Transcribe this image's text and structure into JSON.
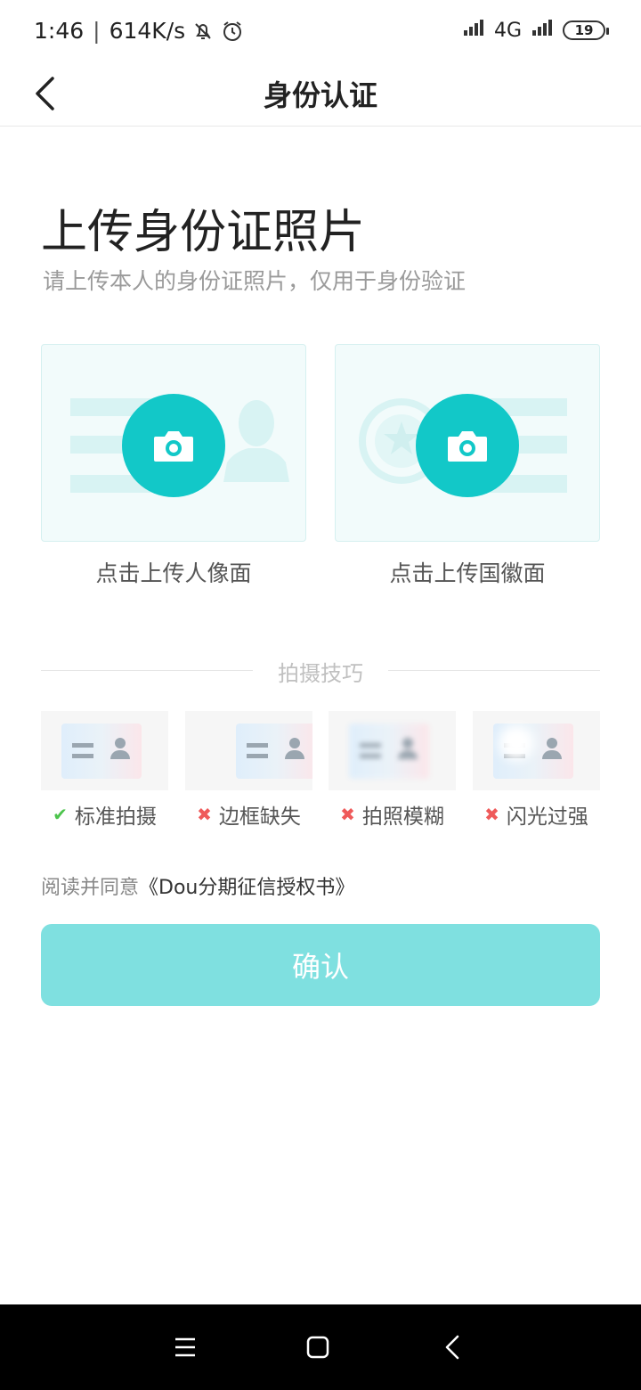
{
  "status_bar": {
    "time": "1:46",
    "separator": "|",
    "speed": "614K/s",
    "network": "4G",
    "battery": "19"
  },
  "nav": {
    "title": "身份认证"
  },
  "page": {
    "title": "上传身份证照片",
    "subtitle": "请上传本人的身份证照片，仅用于身份验证"
  },
  "upload": {
    "front_label": "点击上传人像面",
    "back_label": "点击上传国徽面"
  },
  "tips": {
    "title": "拍摄技巧",
    "items": [
      {
        "label": "标准拍摄",
        "mark": "✔"
      },
      {
        "label": "边框缺失",
        "mark": "✖"
      },
      {
        "label": "拍照模糊",
        "mark": "✖"
      },
      {
        "label": "闪光过强",
        "mark": "✖"
      }
    ]
  },
  "agreement": {
    "prefix": "阅读并同意",
    "link": "《Dou分期征信授权书》"
  },
  "confirm_label": "确认",
  "colors": {
    "accent": "#12c8c8",
    "button_disabled": "#7fe0e0",
    "ok": "#4cc44c",
    "bad": "#ef5a5a"
  }
}
